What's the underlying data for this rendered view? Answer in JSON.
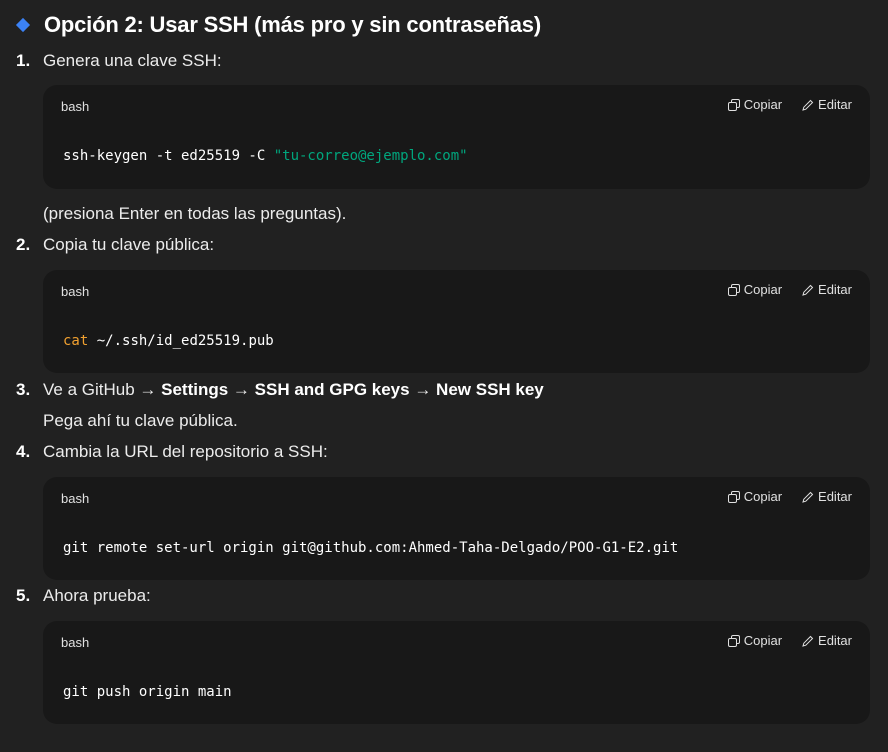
{
  "section_title": "Opción 2: Usar SSH (más pro y sin contraseñas)",
  "steps": [
    {
      "number": "1.",
      "text": "Genera una clave SSH:",
      "code": {
        "lang": "bash",
        "copy": "Copiar",
        "edit": "Editar",
        "cmd": "ssh-keygen -t ed25519 -C ",
        "str": "\"tu-correo@ejemplo.com\""
      },
      "after": "(presiona Enter en todas las preguntas)."
    },
    {
      "number": "2.",
      "text": "Copia tu clave pública:",
      "code": {
        "lang": "bash",
        "copy": "Copiar",
        "edit": "Editar",
        "kw": "cat",
        "cmd": " ~/.ssh/id_ed25519.pub"
      }
    },
    {
      "number": "3.",
      "parts": [
        "Ve a GitHub → ",
        "Settings",
        " → ",
        "SSH and GPG keys",
        " → ",
        "New SSH key"
      ],
      "after": "Pega ahí tu clave pública."
    },
    {
      "number": "4.",
      "text": "Cambia la URL del repositorio a SSH:",
      "code": {
        "lang": "bash",
        "copy": "Copiar",
        "edit": "Editar",
        "cmd": "git remote set-url origin git@github.com:Ahmed-Taha-Delgado/POO-G1-E2.git"
      }
    },
    {
      "number": "5.",
      "text": "Ahora prueba:",
      "code": {
        "lang": "bash",
        "copy": "Copiar",
        "edit": "Editar",
        "cmd": "git push origin main"
      }
    }
  ],
  "icons": {
    "bullet": "diamond-icon",
    "copy": "copy-icon",
    "edit": "pencil-icon"
  },
  "colors": {
    "background": "#212121",
    "code_bg": "#181818",
    "bullet": "#3b82f6",
    "string": "#00a67d",
    "keyword": "#f0a030"
  }
}
